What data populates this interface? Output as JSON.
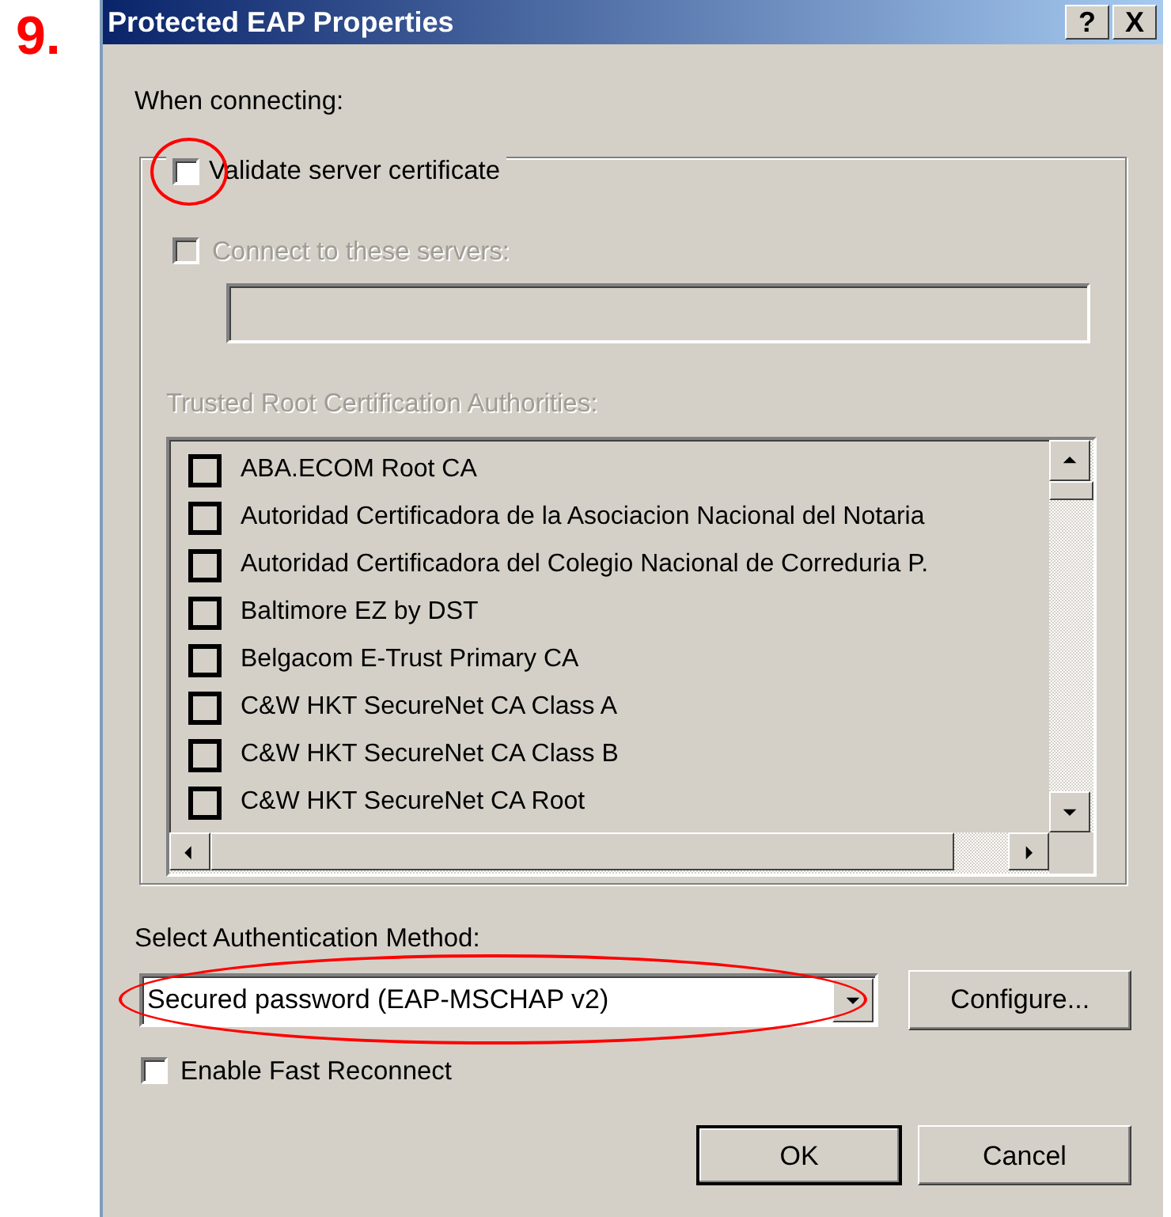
{
  "step_label": "9.",
  "window": {
    "title": "Protected EAP Properties",
    "title_buttons": [
      "?",
      "X"
    ]
  },
  "when_connecting_label": "When connecting:",
  "validate_server_certificate": {
    "label": "Validate server certificate",
    "checked": false,
    "highlighted": true
  },
  "connect_to_servers": {
    "label": "Connect to these servers:",
    "checked": false,
    "disabled": true
  },
  "servers_field": {
    "disabled": true
  },
  "trusted_root_label": "Trusted Root Certification Authorities:",
  "trusted_root_list": [
    {
      "label": "ABA.ECOM Root CA",
      "checked": false
    },
    {
      "label": "Autoridad Certificadora de la Asociacion Nacional del Notaria",
      "checked": false
    },
    {
      "label": "Autoridad Certificadora del Colegio Nacional de Correduria P.",
      "checked": false
    },
    {
      "label": "Baltimore EZ by DST",
      "checked": false
    },
    {
      "label": "Belgacom E-Trust Primary CA",
      "checked": false
    },
    {
      "label": "C&W HKT SecureNet CA Class A",
      "checked": false
    },
    {
      "label": "C&W HKT SecureNet CA Class B",
      "checked": false
    },
    {
      "label": "C&W HKT SecureNet CA Root",
      "checked": false
    }
  ],
  "auth_method_label": "Select Authentication Method:",
  "auth_method": {
    "value": "Secured password (EAP-MSCHAP v2)",
    "highlighted": true
  },
  "configure_button": "Configure...",
  "enable_fast_reconnect": {
    "label": "Enable Fast Reconnect",
    "checked": false
  },
  "buttons": [
    "OK",
    "Cancel"
  ]
}
